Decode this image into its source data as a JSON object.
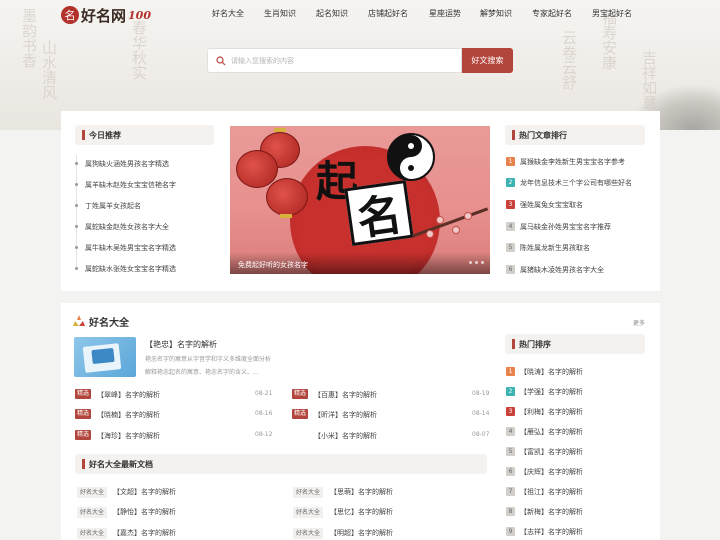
{
  "brand": {
    "seal": "名",
    "name": "好名网",
    "suffix": "100"
  },
  "nav": [
    "好名大全",
    "生肖知识",
    "起名知识",
    "店铺起好名",
    "星座运势",
    "解梦知识",
    "专家起好名",
    "男宝起好名"
  ],
  "search": {
    "placeholder": "请输入您搜索的内容",
    "button": "好文搜索"
  },
  "today": {
    "title": "今日推荐",
    "items": [
      "属狗缺火涵姓男孩名字精选",
      "属羊缺木赵姓女宝宝信艳名字",
      "丁姓属羊女孩起名",
      "属蛇缺金赵姓女孩名字大全",
      "属牛缺木吴姓男宝宝名字精选",
      "属蛇缺水张姓女宝宝名字精选"
    ]
  },
  "banner": {
    "char1": "起",
    "char2": "名",
    "caption": "免费起好听的女孩名字"
  },
  "hot_articles": {
    "title": "热门文章排行",
    "items": [
      {
        "n": "1",
        "text": "属猴缺金李姓新生男宝宝名字参考"
      },
      {
        "n": "2",
        "text": "龙年信息技术三个字公司有哪些好名"
      },
      {
        "n": "3",
        "text": "强姓属兔女宝宝取名"
      },
      {
        "n": "4",
        "text": "属马缺金孙姓男宝宝名字推荐"
      },
      {
        "n": "5",
        "text": "陈姓属龙新生男孩取名"
      },
      {
        "n": "6",
        "text": "属猪缺木凌姓男孩名字大全"
      }
    ]
  },
  "names": {
    "title": "好名大全",
    "more": "更多",
    "feature": {
      "title": "【艳忠】名字的解析",
      "desc": "艳忠名字的寓意从字音学和字义多维度全面分析解释艳忠起名的寓意、艳忠名字的含义、..."
    },
    "tag": "精选",
    "left": [
      {
        "text": "【翠峰】名字的解析",
        "date": "08-21"
      },
      {
        "text": "【晓楠】名字的解析",
        "date": "08-16"
      },
      {
        "text": "【海珍】名字的解析",
        "date": "08-12"
      }
    ],
    "right": [
      {
        "text": "【百惠】名字的解析",
        "date": "08-19"
      },
      {
        "text": "【昕洋】名字的解析",
        "date": "08-14"
      },
      {
        "text": "【小米】名字的解析",
        "date": "08-07"
      }
    ]
  },
  "latest": {
    "title": "好名大全最新文档",
    "kw": "好名大全",
    "left": [
      "【文超】名字的解析",
      "【静怡】名字的解析",
      "【嘉杰】名字的解析"
    ],
    "right": [
      "【思萌】名字的解析",
      "【思忆】名字的解析",
      "【明超】名字的解析"
    ]
  },
  "hot_rank": {
    "title": "热门排序",
    "items": [
      {
        "n": "1",
        "text": "【晓涛】名字的解析"
      },
      {
        "n": "2",
        "text": "【学强】名字的解析"
      },
      {
        "n": "3",
        "text": "【利梅】名字的解析"
      },
      {
        "n": "4",
        "text": "【雁弘】名字的解析"
      },
      {
        "n": "5",
        "text": "【富凯】名字的解析"
      },
      {
        "n": "6",
        "text": "【庆辉】名字的解析"
      },
      {
        "n": "7",
        "text": "【祖江】名字的解析"
      },
      {
        "n": "8",
        "text": "【新梅】名字的解析"
      },
      {
        "n": "9",
        "text": "【志祥】名字的解析"
      }
    ]
  },
  "colors": {
    "accent": "#b3463c",
    "rank1": "#e8824c",
    "rank2": "#3cb3b1",
    "rank3": "#c8423a",
    "rank_other": "#d2cfcb"
  }
}
